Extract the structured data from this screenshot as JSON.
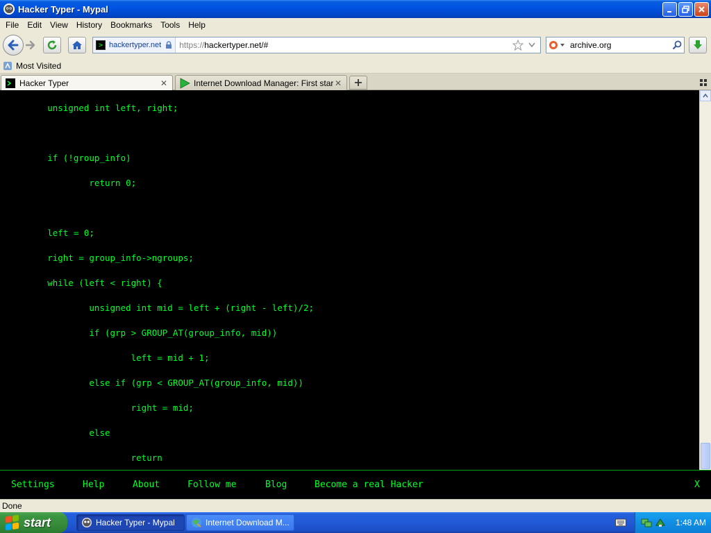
{
  "window": {
    "title": "Hacker Typer - Mypal"
  },
  "menu": [
    "File",
    "Edit",
    "View",
    "History",
    "Bookmarks",
    "Tools",
    "Help"
  ],
  "navbar": {
    "identity": "hackertyper.net",
    "url_scheme": "https://",
    "url_rest": "hackertyper.net/#",
    "search_text": "archive.org"
  },
  "bookmarks": {
    "most_visited": "Most Visited"
  },
  "tabs": [
    {
      "label": "Hacker Typer",
      "close": "✕"
    },
    {
      "label": "Internet Download Manager: First start",
      "close": "✕"
    }
  ],
  "code_lines": [
    "        unsigned int left, right;",
    "        if (!group_info)",
    "                return 0;",
    "        left = 0;",
    "        right = group_info->ngroups;",
    "        while (left < right) {",
    "                unsigned int mid = left + (right - left)/2;",
    "                if (grp > GROUP_AT(group_info, mid))",
    "                        left = mid + 1;",
    "                else if (grp < GROUP_AT(group_info, mid))",
    "                        right = mid;",
    "                else",
    "                        return"
  ],
  "footer": {
    "settings": "Settings",
    "help": "Help",
    "about": "About",
    "follow": "Follow me",
    "blog": "Blog",
    "hacker": "Become a real Hacker",
    "close": "X"
  },
  "status": {
    "text": "Done"
  },
  "taskbar": {
    "start": "start",
    "task1": "Hacker Typer - Mypal",
    "task2": "Internet Download M...",
    "clock": "1:48 AM"
  },
  "colors": {
    "code_green": "#00ff2a",
    "xp_blue": "#0054e3",
    "start_green": "#3b9440"
  }
}
